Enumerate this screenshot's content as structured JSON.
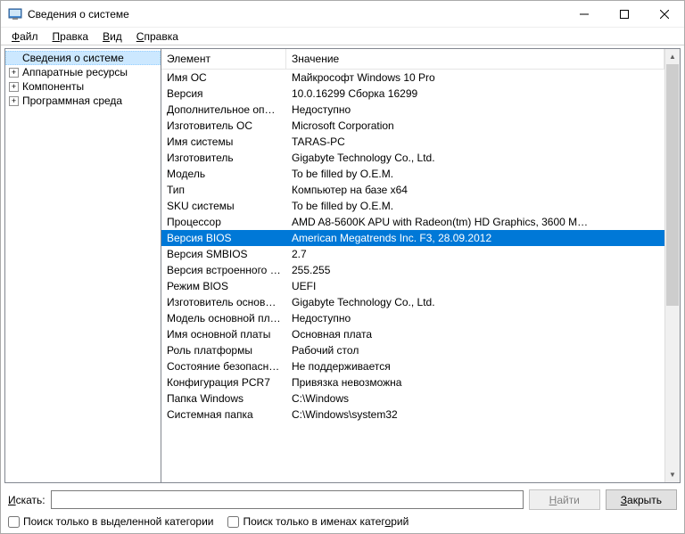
{
  "window": {
    "title": "Сведения о системе"
  },
  "menu": {
    "file": "Файл",
    "edit": "Правка",
    "view": "Вид",
    "help": "Справка"
  },
  "tree": {
    "root": "Сведения о системе",
    "hardware": "Аппаратные ресурсы",
    "components": "Компоненты",
    "software": "Программная среда"
  },
  "columns": {
    "element": "Элемент",
    "value": "Значение"
  },
  "rows": [
    {
      "k": "Имя ОС",
      "v": "Майкрософт Windows 10 Pro"
    },
    {
      "k": "Версия",
      "v": "10.0.16299 Сборка 16299"
    },
    {
      "k": "Дополнительное опис…",
      "v": "Недоступно"
    },
    {
      "k": "Изготовитель ОС",
      "v": "Microsoft Corporation"
    },
    {
      "k": "Имя системы",
      "v": "TARAS-PC"
    },
    {
      "k": "Изготовитель",
      "v": "Gigabyte Technology Co., Ltd."
    },
    {
      "k": "Модель",
      "v": "To be filled by O.E.M."
    },
    {
      "k": "Тип",
      "v": "Компьютер на базе x64"
    },
    {
      "k": "SKU системы",
      "v": "To be filled by O.E.M."
    },
    {
      "k": "Процессор",
      "v": "AMD A8-5600K APU with Radeon(tm) HD Graphics, 3600 M…"
    },
    {
      "k": "Версия BIOS",
      "v": "American Megatrends Inc. F3, 28.09.2012",
      "selected": true
    },
    {
      "k": "Версия SMBIOS",
      "v": "2.7"
    },
    {
      "k": "Версия встроенного к…",
      "v": "255.255"
    },
    {
      "k": "Режим BIOS",
      "v": "UEFI"
    },
    {
      "k": "Изготовитель основно…",
      "v": "Gigabyte Technology Co., Ltd."
    },
    {
      "k": "Модель основной пла…",
      "v": "Недоступно"
    },
    {
      "k": "Имя основной платы",
      "v": "Основная плата"
    },
    {
      "k": "Роль платформы",
      "v": "Рабочий стол"
    },
    {
      "k": "Состояние безопасно…",
      "v": "Не поддерживается"
    },
    {
      "k": "Конфигурация PCR7",
      "v": "Привязка невозможна"
    },
    {
      "k": "Папка Windows",
      "v": "C:\\Windows"
    },
    {
      "k": "Системная папка",
      "v": "C:\\Windows\\system32"
    }
  ],
  "bottom": {
    "search_label": "Искать:",
    "find_btn": "Найти",
    "close_btn": "Закрыть",
    "chk_selected": "Поиск только в выделенной категории",
    "chk_names": "Поиск только в именах категорий"
  }
}
